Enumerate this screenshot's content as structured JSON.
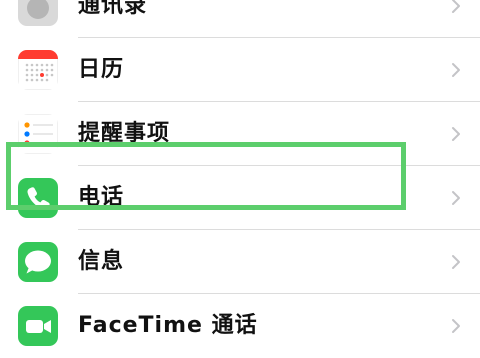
{
  "settings_list": {
    "items": [
      {
        "label": "通讯录",
        "icon": "contacts-icon"
      },
      {
        "label": "日历",
        "icon": "calendar-icon"
      },
      {
        "label": "提醒事项",
        "icon": "reminders-icon"
      },
      {
        "label": "电话",
        "icon": "phone-icon",
        "highlighted": true
      },
      {
        "label": "信息",
        "icon": "messages-icon"
      },
      {
        "label": "FaceTime 通话",
        "icon": "facetime-icon"
      }
    ]
  },
  "colors": {
    "highlight_border": "#5cce6c",
    "phone_green": "#34c759",
    "calendar_red": "#ff3b30",
    "chevron": "#c4c4c7"
  }
}
